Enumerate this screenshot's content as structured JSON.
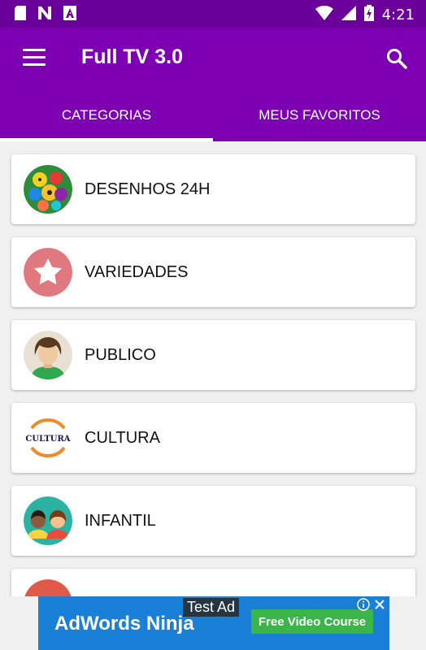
{
  "status_bar": {
    "time": "4:21",
    "icons": [
      "sd-card-icon",
      "n-app-icon",
      "a-app-icon",
      "wifi-icon",
      "signal-icon",
      "battery-charging-icon"
    ]
  },
  "toolbar": {
    "title": "Full TV 3.0",
    "menu_icon": "menu-icon",
    "search_icon": "search-icon"
  },
  "tabs": [
    {
      "label": "CATEGORIAS",
      "selected": true
    },
    {
      "label": "MEUS FAVORITOS",
      "selected": false
    }
  ],
  "categories": [
    {
      "label": "DESENHOS 24H",
      "icon": "cartoon-collage-icon"
    },
    {
      "label": "VARIEDADES",
      "icon": "star-icon"
    },
    {
      "label": "PUBLICO",
      "icon": "person-icon"
    },
    {
      "label": "CULTURA",
      "icon": "cultura-logo-icon",
      "icon_text": "CULTURA"
    },
    {
      "label": "INFANTIL",
      "icon": "kids-icon"
    },
    {
      "label": "",
      "icon": "red-circle-icon"
    }
  ],
  "ad": {
    "test_label": "Test Ad",
    "brand": "AdWords Ninja",
    "cta": "Free Video Course"
  },
  "colors": {
    "status_bar": "#6a0099",
    "primary": "#7d00b3",
    "background": "#f0f0f0",
    "ad_blue": "#1a7fd6",
    "ad_green": "#3bb54a"
  }
}
